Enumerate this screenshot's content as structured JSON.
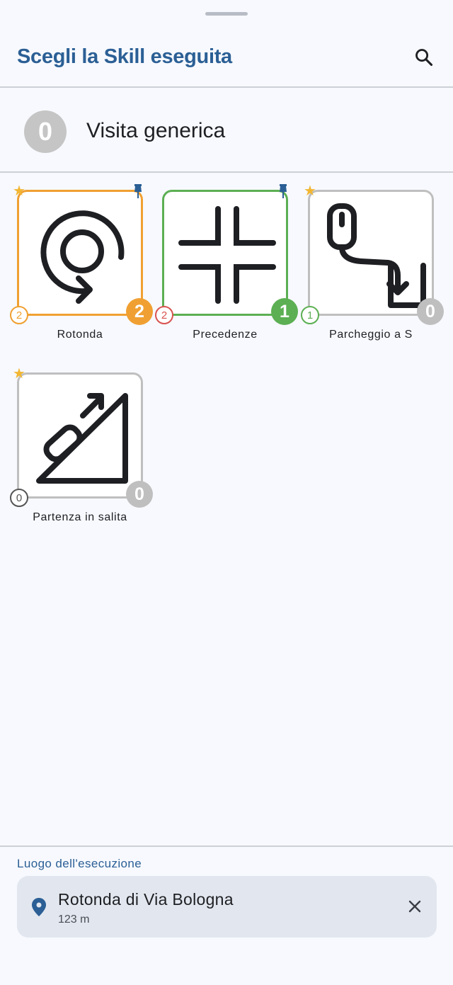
{
  "header": {
    "title": "Scegli la Skill eseguita",
    "search_icon": "search-icon"
  },
  "visita": {
    "count": "0",
    "label": "Visita generica"
  },
  "skills": [
    {
      "label": "Rotonda",
      "icon": "roundabout-icon",
      "color": "#f0a032",
      "small_count": "2",
      "small_color": "#f0a032",
      "big_count": "2",
      "big_color": "#f0a032",
      "starred": true,
      "pinned": true
    },
    {
      "label": "Precedenze",
      "icon": "intersection-icon",
      "color": "#5caf53",
      "small_count": "2",
      "small_color": "#d9534f",
      "big_count": "1",
      "big_color": "#5caf53",
      "starred": false,
      "pinned": true
    },
    {
      "label": "Parcheggio a S",
      "icon": "parking-s-icon",
      "color": "#bfbfbf",
      "small_count": "1",
      "small_color": "#5caf53",
      "big_count": "0",
      "big_color": "#bfbfbf",
      "starred": true,
      "pinned": false
    },
    {
      "label": "Partenza in salita",
      "icon": "hill-start-icon",
      "color": "#bfbfbf",
      "small_count": "0",
      "small_color": "#555555",
      "big_count": "0",
      "big_color": "#bfbfbf",
      "starred": true,
      "pinned": false
    }
  ],
  "footer": {
    "label": "Luogo dell'esecuzione",
    "location_name": "Rotonda di Via Bologna",
    "distance": "123 m",
    "location_icon": "location-pin-icon",
    "close_icon": "close-icon"
  },
  "colors": {
    "accent": "#2b5f95",
    "pin": "#2b5f95",
    "star": "#f2b632"
  }
}
